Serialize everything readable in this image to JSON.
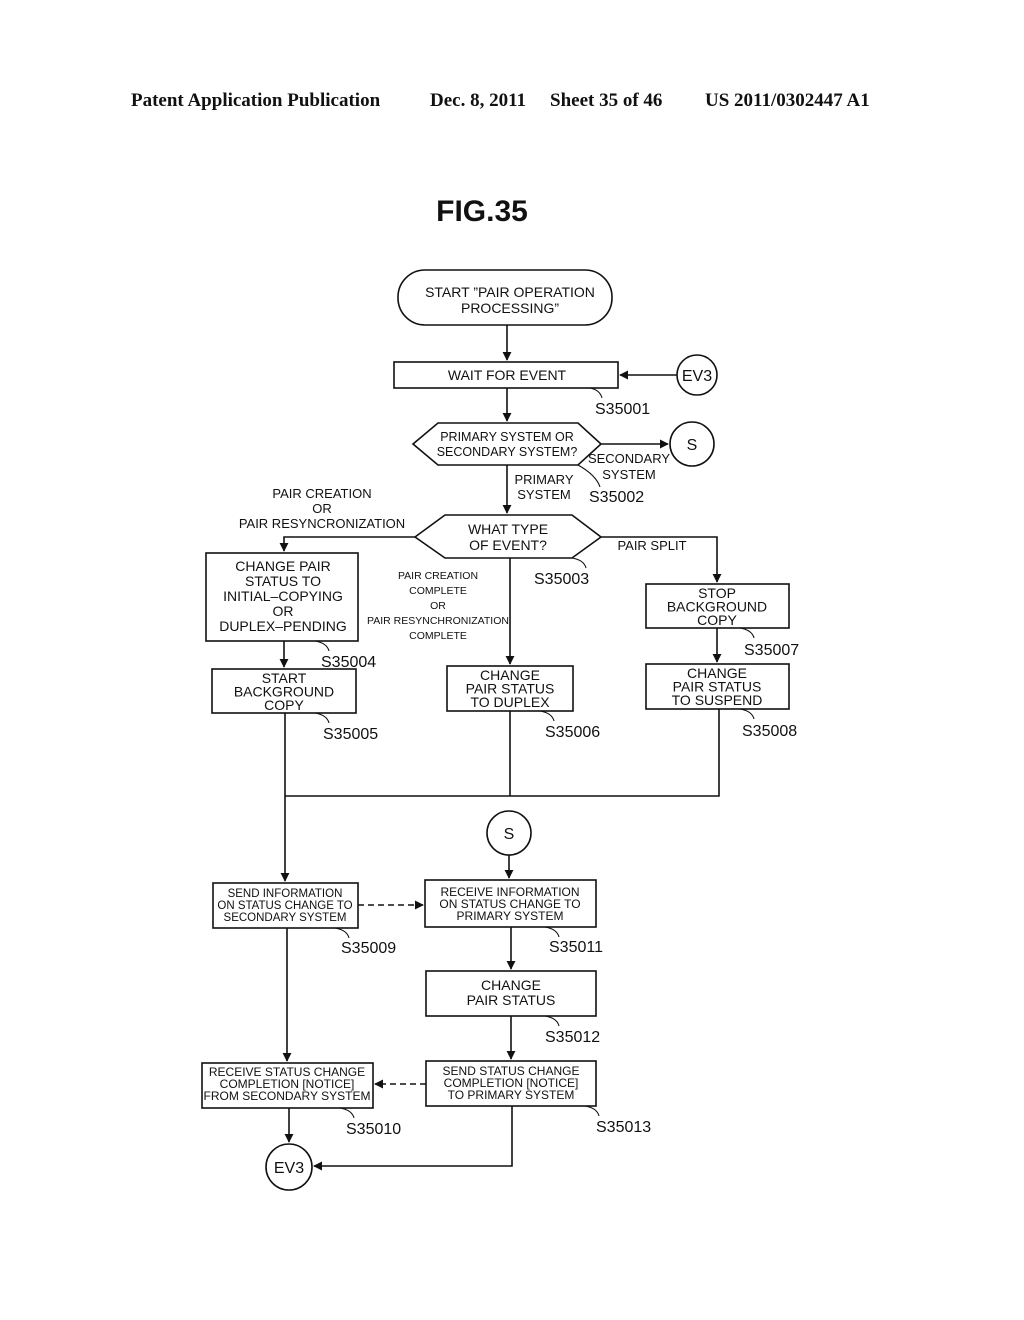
{
  "header": {
    "publication": "Patent Application Publication",
    "date": "Dec. 8, 2011",
    "sheet": "Sheet 35 of 46",
    "number": "US 2011/0302447 A1"
  },
  "figure": {
    "title": "FIG.35"
  },
  "nodes": {
    "start": [
      "START ”PAIR OPERATION",
      "PROCESSING”"
    ],
    "wait": [
      "WAIT FOR EVENT"
    ],
    "ev3_in": [
      "EV3"
    ],
    "decision_system": [
      "PRIMARY SYSTEM OR",
      "SECONDARY SYSTEM?"
    ],
    "s_out": [
      "S"
    ],
    "decision_event": [
      "WHAT TYPE",
      "OF EVENT?"
    ],
    "s35004": [
      "CHANGE PAIR",
      "STATUS TO",
      "INITIAL–COPYING",
      "OR",
      "DUPLEX–PENDING"
    ],
    "s35005": [
      "START",
      "BACKGROUND",
      "COPY"
    ],
    "s35006": [
      "CHANGE",
      "PAIR STATUS",
      "TO DUPLEX"
    ],
    "s35007": [
      "STOP",
      "BACKGROUND",
      "COPY"
    ],
    "s35008": [
      "CHANGE",
      "PAIR STATUS",
      "TO SUSPEND"
    ],
    "s_in": [
      "S"
    ],
    "s35009": [
      "SEND INFORMATION",
      "ON STATUS CHANGE TO",
      "SECONDARY SYSTEM"
    ],
    "s35011": [
      "RECEIVE INFORMATION",
      "ON STATUS CHANGE TO",
      "PRIMARY SYSTEM"
    ],
    "s35012": [
      "CHANGE",
      "PAIR STATUS"
    ],
    "s35010": [
      "RECEIVE STATUS CHANGE",
      "COMPLETION [NOTICE]",
      "FROM SECONDARY SYSTEM"
    ],
    "s35013": [
      "SEND STATUS CHANGE",
      "COMPLETION [NOTICE]",
      "TO PRIMARY SYSTEM"
    ],
    "ev3_out": [
      "EV3"
    ]
  },
  "branch_labels": {
    "secondary": [
      "SECONDARY",
      "SYSTEM"
    ],
    "primary": [
      "PRIMARY",
      "SYSTEM"
    ],
    "pair_creation": [
      "PAIR CREATION",
      "OR",
      "PAIR RESYNCRONIZATION"
    ],
    "pair_complete": [
      "PAIR CREATION",
      "COMPLETE",
      "OR",
      "PAIR RESYNCHRONIZATION",
      "COMPLETE"
    ],
    "pair_split": [
      "PAIR SPLIT"
    ]
  },
  "step_labels": {
    "s35001": "S35001",
    "s35002": "S35002",
    "s35003": "S35003",
    "s35004": "S35004",
    "s35005": "S35005",
    "s35006": "S35006",
    "s35007": "S35007",
    "s35008": "S35008",
    "s35009": "S35009",
    "s35010": "S35010",
    "s35011": "S35011",
    "s35012": "S35012",
    "s35013": "S35013"
  }
}
